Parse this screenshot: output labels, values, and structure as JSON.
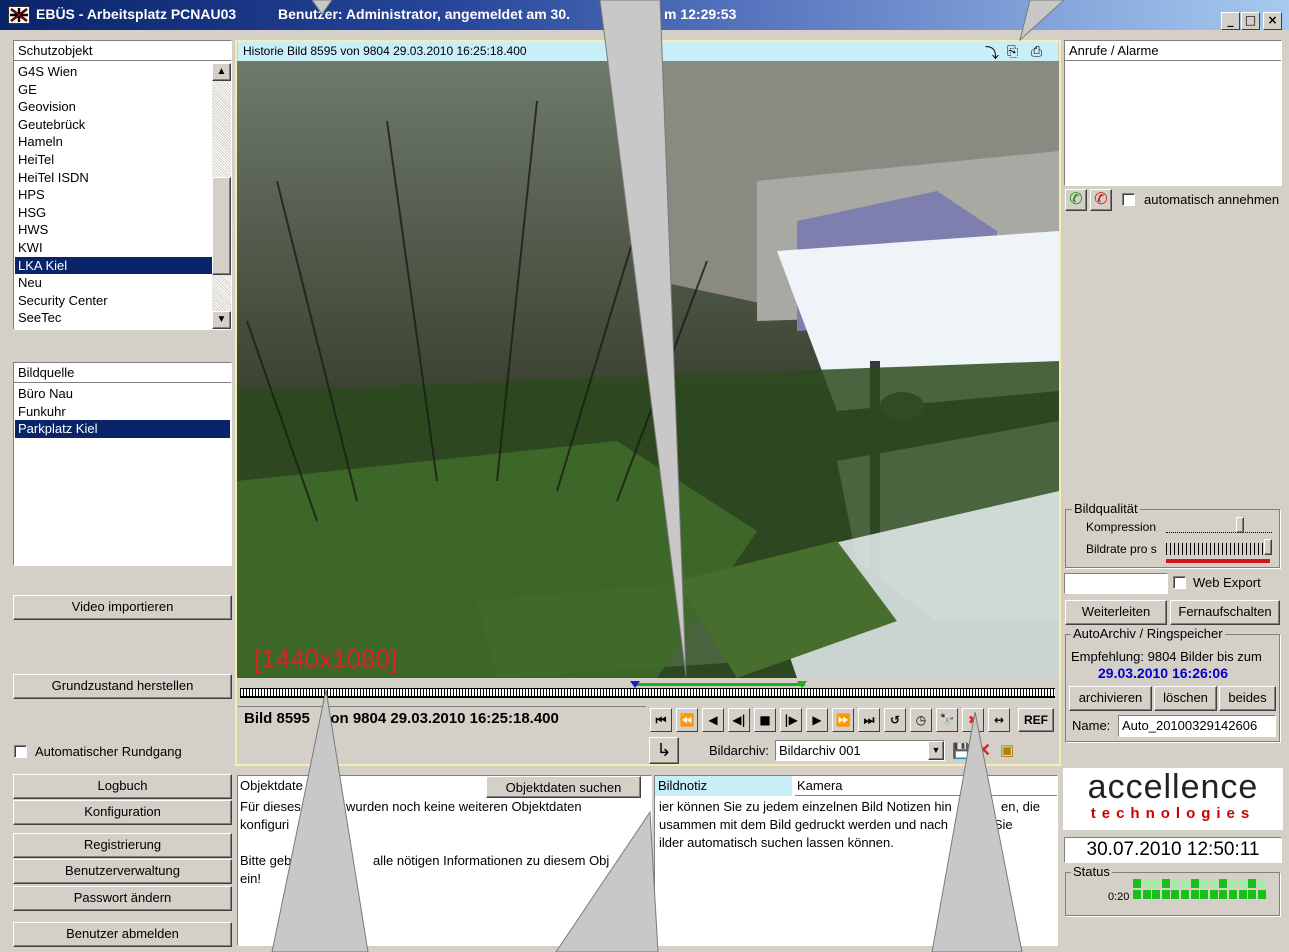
{
  "window": {
    "app_title": "EBÜS - Arbeitsplatz PCNAU03",
    "user_info": "Benutzer: Administrator, angemeldet am 30.",
    "user_info_tail": "m 12:29:53",
    "min_label": "_",
    "max_label": "□",
    "close_label": "×"
  },
  "schutzobjekt": {
    "header": "Schutzobjekt",
    "items": [
      "G4S Wien",
      "GE",
      "Geovision",
      "Geutebrück",
      "Hameln",
      "HeiTel",
      "HeiTel ISDN",
      "HPS",
      "HSG",
      "HWS",
      "KWI",
      "LKA Kiel",
      "Neu",
      "Security Center",
      "SeeTec"
    ],
    "selected": "LKA Kiel",
    "scroll_up": "▲",
    "scroll_down": "▼"
  },
  "bildquelle": {
    "header": "Bildquelle",
    "items": [
      "Büro Nau",
      "Funkuhr",
      "Parkplatz Kiel"
    ],
    "selected": "Parkplatz Kiel"
  },
  "left_buttons": {
    "video_import": "Video importieren",
    "grundzustand": "Grundzustand herstellen",
    "rundgang_label": "Automatischer Rundgang",
    "logbuch": "Logbuch",
    "konfiguration": "Konfiguration",
    "registrierung": "Registrierung",
    "benutzerverwaltung": "Benutzerverwaltung",
    "passwort": "Passwort ändern",
    "abmelden": "Benutzer abmelden"
  },
  "viewer": {
    "header": "Historie Bild 8595 von 9804   29.03.2010 16:25:18.400",
    "resolution": "[1440x1080]",
    "status_prefix": "Bild 8595",
    "status_suffix": "von 9804  29.03.2010 16:25:18.400",
    "ref_label": "REF",
    "bildarchiv_label": "Bildarchiv:",
    "bildarchiv_value": "Bildarchiv 001",
    "dropdown_arrow": "▼"
  },
  "controls": [
    "⏮",
    "⏪",
    "◀",
    "◀|",
    "■",
    "|▶",
    "▶",
    "⏩",
    "⏭",
    "↺",
    "◷",
    "🔭",
    "✖",
    "↔"
  ],
  "bottom": {
    "objektdaten_tab": "Objektdate",
    "objektdaten_btn": "Objektdaten suchen",
    "objekt_line1a": "Für dieses",
    "objekt_line1b": "wurden noch keine weiteren Objektdaten",
    "objekt_line2": "konfiguri",
    "objekt_line3a": "Bitte geb",
    "objekt_line3b": "alle nötigen Informationen zu diesem Obj",
    "objekt_line4": "ein!",
    "bildnotiz_tab": "Bildnotiz",
    "kamera_tab": "Kamera",
    "notiz_line1a": "ier können Sie zu jedem einzelnen Bild Notizen hin",
    "notiz_line1b": "en, die",
    "notiz_line2a": "usammen mit dem Bild gedruckt werden und nach",
    "notiz_line2b": "n Sie",
    "notiz_line3": "ilder automatisch suchen lassen können."
  },
  "right": {
    "anrufe_header": "Anrufe / Alarme",
    "auto_annehmen": "automatisch annehmen",
    "bildqualitaet": "Bildqualität",
    "kompression": "Kompression",
    "bildrate": "Bildrate pro s",
    "web_export": "Web Export",
    "weiterleiten": "Weiterleiten",
    "fernaufschalten": "Fernaufschalten",
    "autoarchiv": "AutoArchiv / Ringspeicher",
    "empfehlung": "Empfehlung: 9804 Bilder bis zum",
    "empfehlung_date": "29.03.2010 16:26:06",
    "archivieren": "archivieren",
    "loeschen": "löschen",
    "beides": "beides",
    "name_label": "Name:",
    "name_value": "Auto_20100329142606",
    "logo_main": "accellence",
    "logo_sub": "technologies",
    "clock": "30.07.2010 12:50:11",
    "status_label": "Status",
    "status_time": "0:20"
  },
  "colors": {
    "title_grad_start": "#0a246a",
    "selection": "#0a246a",
    "logo_red": "#cc0000",
    "resolution_red": "#e02020",
    "empfehlung_blue": "#0000cc"
  }
}
